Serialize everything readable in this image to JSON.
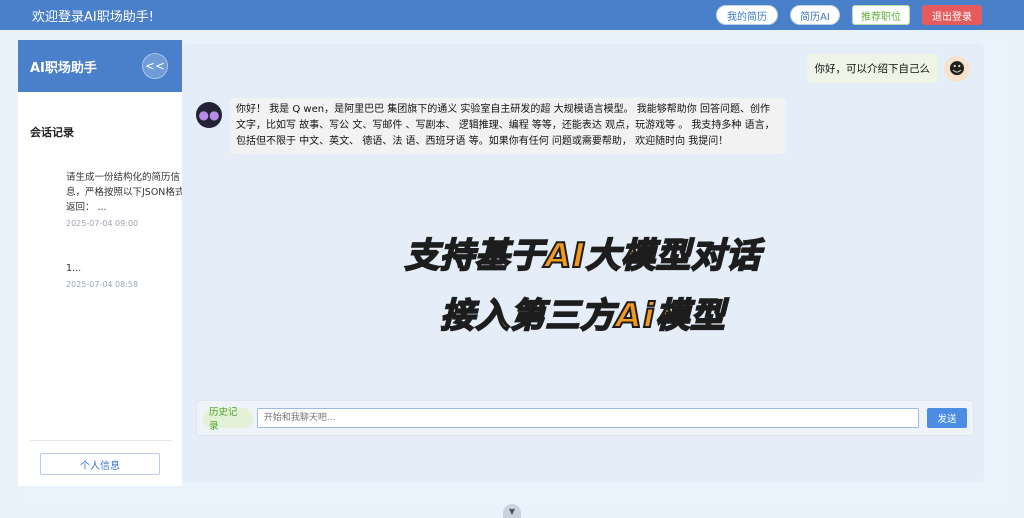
{
  "header": {
    "welcome": "欢迎登录AI职场助手!",
    "buttons": {
      "my_resume": "我的简历",
      "resume_ai": "简历AI",
      "recommend_jobs": "推荐职位",
      "logout": "退出登录"
    }
  },
  "sidebar": {
    "title": "AI职场助手",
    "collapse": "<<",
    "section_title": "会话记录",
    "sessions": [
      {
        "title": "请生成一份结构化的简历信息，严格按照以下JSON格式返回：  ...",
        "time": "2025-07-04 09:00"
      },
      {
        "title": "1...",
        "time": "2025-07-04 08:58"
      }
    ],
    "profile_button": "个人信息"
  },
  "chat": {
    "user_message": "你好，可以介绍下自己么",
    "ai_message": "你好！ 我是 Q wen，是阿里巴巴 集团旗下的通义 实验室自主研发的超 大规模语言模型。 我能够帮助你 回答问题、创作 文字，比如写 故事、写公 文、写邮件 、写剧本、 逻辑推理、编程 等等，还能表达 观点，玩游戏等 。 我支持多种 语言，包括但不限于 中文、英文、 德语、法 语、西班牙语 等。如果你有任何 问题或需要帮助， 欢迎随时向 我提问！",
    "promo_line1": "支持基于AI大模型对话",
    "promo_line2": "接入第三方Ai模型",
    "history_button": "历史记录",
    "input_placeholder": "开始和我聊天吧...",
    "send_button": "发送"
  },
  "icons": {
    "user_avatar": "girl-avatar-icon",
    "ai_avatar": "robot-avatar-icon",
    "scroll": "chevron-down-icon"
  },
  "colors": {
    "primary": "#4a7fc9",
    "logout": "#e55b5b",
    "promo_text": "#f29a1e"
  }
}
